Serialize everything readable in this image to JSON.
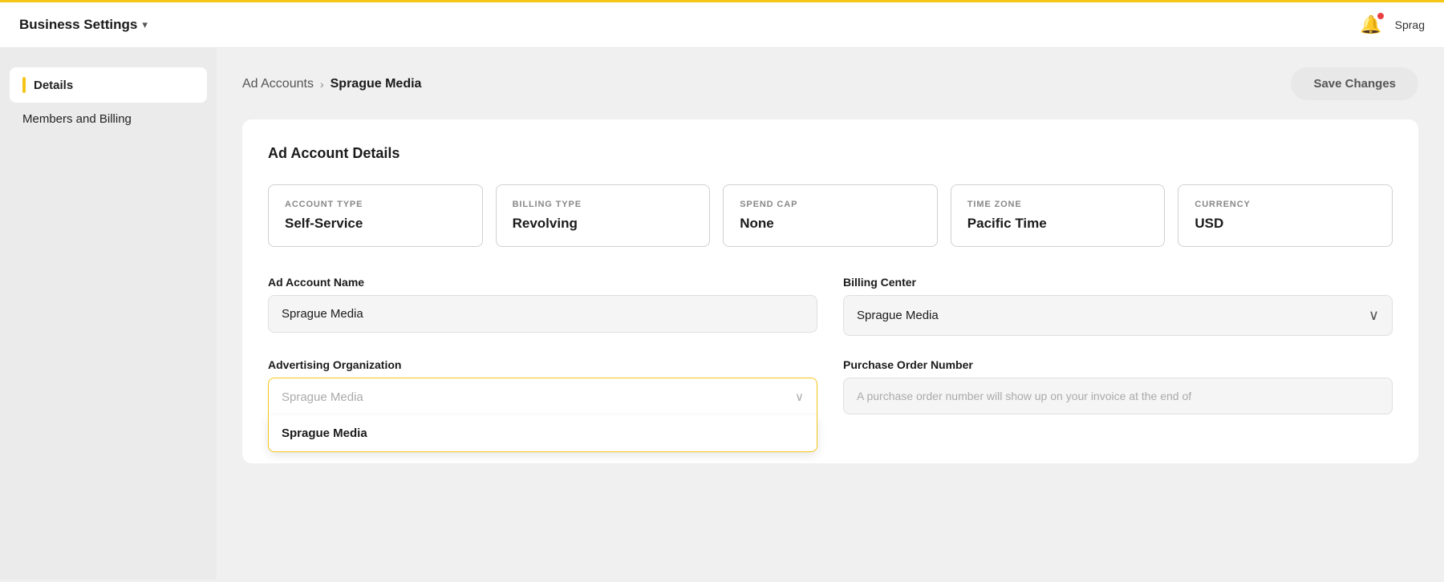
{
  "topbar": {
    "title": "Business Settings",
    "chevron": "▾",
    "notification_icon": "🔔",
    "user_name": "Sprag"
  },
  "sidebar": {
    "items": [
      {
        "id": "details",
        "label": "Details",
        "active": true
      },
      {
        "id": "members-billing",
        "label": "Members and Billing",
        "active": false
      }
    ]
  },
  "breadcrumb": {
    "link": "Ad Accounts",
    "separator": "›",
    "current": "Sprague Media"
  },
  "toolbar": {
    "save_label": "Save Changes"
  },
  "card": {
    "title": "Ad Account Details",
    "stats": [
      {
        "label": "ACCOUNT TYPE",
        "value": "Self-Service"
      },
      {
        "label": "BILLING TYPE",
        "value": "Revolving"
      },
      {
        "label": "SPEND CAP",
        "value": "None"
      },
      {
        "label": "TIME ZONE",
        "value": "Pacific Time"
      },
      {
        "label": "CURRENCY",
        "value": "USD"
      }
    ],
    "fields": {
      "ad_account_name_label": "Ad Account Name",
      "ad_account_name_value": "Sprague Media",
      "billing_center_label": "Billing Center",
      "billing_center_value": "Sprague Media",
      "advertising_org_label": "Advertising Organization",
      "advertising_org_placeholder": "Sprague Media",
      "advertising_org_dropdown_option": "Sprague Media",
      "purchase_order_label": "Purchase Order Number",
      "purchase_order_placeholder": "A purchase order number will show up on your invoice at the end of"
    }
  }
}
